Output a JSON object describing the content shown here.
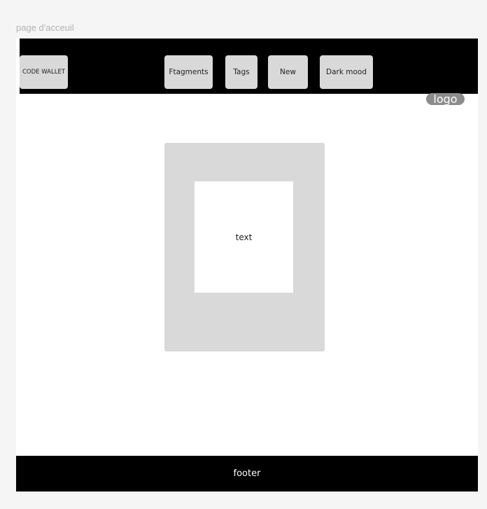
{
  "frame": {
    "label": "page d'acceuil"
  },
  "navbar": {
    "brand_label": "CODE WALLET",
    "fragments_label": "Ftagments",
    "tags_label": "Tags",
    "new_label": "New",
    "dark_mode_label": "Dark mood"
  },
  "logo": {
    "label": "logo"
  },
  "main": {
    "card_text": "text"
  },
  "footer": {
    "label": "footer"
  }
}
